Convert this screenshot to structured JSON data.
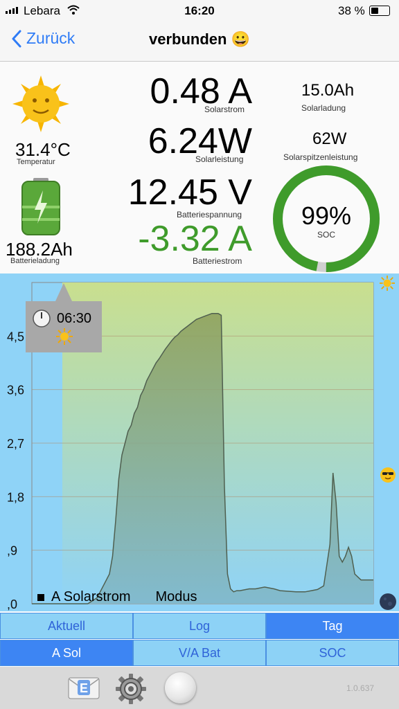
{
  "status": {
    "carrier": "Lebara",
    "time": "16:20",
    "battery": "38 %"
  },
  "nav": {
    "back_label": "Zurück",
    "title": "verbunden",
    "title_emoji": "😀"
  },
  "metrics": {
    "temperature": {
      "value": "31.4°C",
      "label": "Temperatur"
    },
    "battery_charge": {
      "value": "188.2Ah",
      "label": "Batterieladung"
    },
    "solar_current": {
      "value": "0.48 A",
      "label": "Solarstrom"
    },
    "solar_power": {
      "value": "6.24W",
      "label": "Solarleistung"
    },
    "battery_voltage": {
      "value": "12.45 V",
      "label": "Batteriespannung"
    },
    "battery_current": {
      "value": "-3.32 A",
      "label": "Batteriestrom"
    },
    "solar_charge": {
      "value": "15.0Ah",
      "label": "Solarladung"
    },
    "solar_peak": {
      "value": "62W",
      "label": "Solarspitzenleistung"
    },
    "soc": {
      "value": "99%",
      "label": "SOC",
      "percent": 99
    }
  },
  "chart_data": {
    "type": "area",
    "ylim": [
      0,
      5.4
    ],
    "yticks": [
      "4,5",
      "3,6",
      "2,7",
      "1,8",
      ",9",
      ",0"
    ],
    "ytick_values": [
      4.5,
      3.6,
      2.7,
      1.8,
      0.9,
      0.0
    ],
    "xlim": [
      0,
      100
    ],
    "series": [
      {
        "name": "A Solarstrom",
        "x": [
          0,
          18,
          21,
          23,
          25,
          26,
          27,
          28,
          29,
          30,
          31,
          32,
          33,
          34,
          35,
          36,
          37,
          38,
          39,
          40,
          41,
          42,
          43,
          44,
          45,
          46,
          47,
          48,
          49,
          50,
          51,
          52,
          53,
          54,
          55,
          56,
          57,
          58,
          59,
          60,
          61,
          62,
          63,
          64,
          65,
          66,
          67,
          70,
          72,
          75,
          78,
          80,
          85,
          88,
          90,
          92,
          94,
          96,
          97,
          98,
          99,
          100,
          101,
          102,
          103,
          104,
          105,
          106,
          107,
          108,
          109,
          110
        ],
        "values": [
          0,
          0,
          0.1,
          0.3,
          0.5,
          0.8,
          1.4,
          2.1,
          2.5,
          2.7,
          2.9,
          3.0,
          3.2,
          3.3,
          3.5,
          3.6,
          3.75,
          3.85,
          3.95,
          4.05,
          4.12,
          4.2,
          4.28,
          4.35,
          4.42,
          4.48,
          4.52,
          4.58,
          4.62,
          4.66,
          4.7,
          4.74,
          4.78,
          4.8,
          4.82,
          4.84,
          4.86,
          4.88,
          4.88,
          4.88,
          4.85,
          2.0,
          0.5,
          0.25,
          0.2,
          0.22,
          0.22,
          0.25,
          0.25,
          0.28,
          0.25,
          0.22,
          0.2,
          0.2,
          0.22,
          0.24,
          0.3,
          1.0,
          2.2,
          1.7,
          0.8,
          0.7,
          0.8,
          0.95,
          0.8,
          0.5,
          0.45,
          0.4,
          0.4,
          0.4,
          0.4,
          0.4
        ]
      }
    ],
    "legend": [
      "A Solarstrom",
      "Modus"
    ],
    "cursor": {
      "time": "06:30"
    }
  },
  "tabs": {
    "row1": [
      "Aktuell",
      "Log",
      "Tag"
    ],
    "row2": [
      "A Sol",
      "V/A Bat",
      "SOC"
    ]
  },
  "footer": {
    "version": "1.0.637"
  },
  "colors": {
    "accent": "#3d85f3",
    "soc_ring": "#3f9b2b",
    "negative_current": "#3f9b2b"
  }
}
